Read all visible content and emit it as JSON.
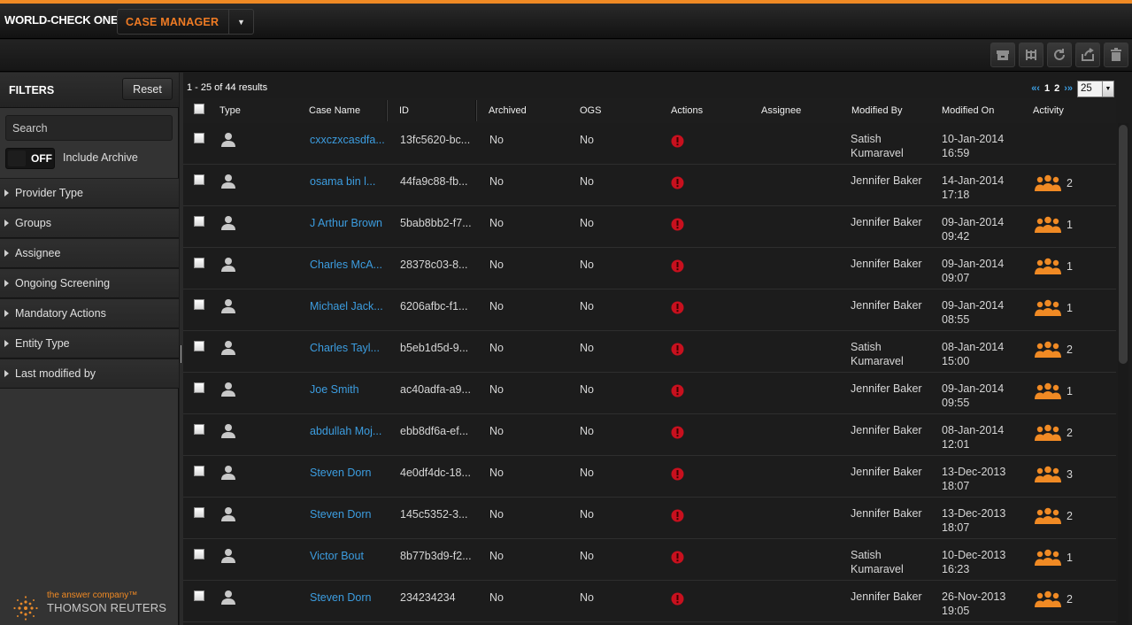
{
  "header": {
    "brand": "WORLD-CHECK ONE",
    "module": "CASE MANAGER"
  },
  "toolbar": {
    "icons": [
      "archive-icon",
      "merge-icon",
      "refresh-icon",
      "export-icon",
      "delete-icon"
    ]
  },
  "sidebar": {
    "title": "FILTERS",
    "reset_label": "Reset",
    "search_placeholder": "Search",
    "archive_toggle_state": "OFF",
    "archive_label": "Include Archive",
    "sections": [
      "Provider Type",
      "Groups",
      "Assignee",
      "Ongoing Screening",
      "Mandatory Actions",
      "Entity Type",
      "Last modified by"
    ],
    "logo": {
      "tagline": "the answer company™",
      "name": "THOMSON REUTERS"
    }
  },
  "grid": {
    "results_summary": "1 - 25 of 44 results",
    "pager": {
      "first": "«‹",
      "page1": "1",
      "page2": "2",
      "next": "›»",
      "per_page": "25"
    },
    "columns": [
      "Type",
      "Case Name",
      "ID",
      "Archived",
      "OGS",
      "Actions",
      "Assignee",
      "Modified By",
      "Modified On",
      "Activity"
    ],
    "colors": {
      "link": "#3c9de0",
      "accent": "#f08a24",
      "alert": "#c8101e"
    },
    "rows": [
      {
        "name": "cxxczxcasdfa...",
        "id": "13fc5620-bc...",
        "archived": "No",
        "ogs": "No",
        "assignee": "",
        "modified_by_1": "Satish",
        "modified_by_2": "Kumaravel",
        "date": "10-Jan-2014",
        "time": "16:59",
        "activity": ""
      },
      {
        "name": "osama bin l...",
        "id": "44fa9c88-fb...",
        "archived": "No",
        "ogs": "No",
        "assignee": "",
        "modified_by_1": "Jennifer Baker",
        "modified_by_2": "",
        "date": "14-Jan-2014",
        "time": "17:18",
        "activity": "2"
      },
      {
        "name": "J Arthur Brown",
        "id": "5bab8bb2-f7...",
        "archived": "No",
        "ogs": "No",
        "assignee": "",
        "modified_by_1": "Jennifer Baker",
        "modified_by_2": "",
        "date": "09-Jan-2014",
        "time": "09:42",
        "activity": "1"
      },
      {
        "name": "Charles McA...",
        "id": "28378c03-8...",
        "archived": "No",
        "ogs": "No",
        "assignee": "",
        "modified_by_1": "Jennifer Baker",
        "modified_by_2": "",
        "date": "09-Jan-2014",
        "time": "09:07",
        "activity": "1"
      },
      {
        "name": "Michael Jack...",
        "id": "6206afbc-f1...",
        "archived": "No",
        "ogs": "No",
        "assignee": "",
        "modified_by_1": "Jennifer Baker",
        "modified_by_2": "",
        "date": "09-Jan-2014",
        "time": "08:55",
        "activity": "1"
      },
      {
        "name": "Charles Tayl...",
        "id": "b5eb1d5d-9...",
        "archived": "No",
        "ogs": "No",
        "assignee": "",
        "modified_by_1": "Satish",
        "modified_by_2": "Kumaravel",
        "date": "08-Jan-2014",
        "time": "15:00",
        "activity": "2"
      },
      {
        "name": "Joe Smith",
        "id": "ac40adfa-a9...",
        "archived": "No",
        "ogs": "No",
        "assignee": "",
        "modified_by_1": "Jennifer Baker",
        "modified_by_2": "",
        "date": "09-Jan-2014",
        "time": "09:55",
        "activity": "1"
      },
      {
        "name": "abdullah Moj...",
        "id": "ebb8df6a-ef...",
        "archived": "No",
        "ogs": "No",
        "assignee": "",
        "modified_by_1": "Jennifer Baker",
        "modified_by_2": "",
        "date": "08-Jan-2014",
        "time": "12:01",
        "activity": "2"
      },
      {
        "name": "Steven Dorn",
        "id": "4e0df4dc-18...",
        "archived": "No",
        "ogs": "No",
        "assignee": "",
        "modified_by_1": "Jennifer Baker",
        "modified_by_2": "",
        "date": "13-Dec-2013",
        "time": "18:07",
        "activity": "3"
      },
      {
        "name": "Steven Dorn",
        "id": "145c5352-3...",
        "archived": "No",
        "ogs": "No",
        "assignee": "",
        "modified_by_1": "Jennifer Baker",
        "modified_by_2": "",
        "date": "13-Dec-2013",
        "time": "18:07",
        "activity": "2"
      },
      {
        "name": "Victor Bout",
        "id": "8b77b3d9-f2...",
        "archived": "No",
        "ogs": "No",
        "assignee": "",
        "modified_by_1": "Satish",
        "modified_by_2": "Kumaravel",
        "date": "10-Dec-2013",
        "time": "16:23",
        "activity": "1"
      },
      {
        "name": "Steven Dorn",
        "id": "234234234",
        "archived": "No",
        "ogs": "No",
        "assignee": "",
        "modified_by_1": "Jennifer Baker",
        "modified_by_2": "",
        "date": "26-Nov-2013",
        "time": "19:05",
        "activity": "2"
      }
    ]
  }
}
